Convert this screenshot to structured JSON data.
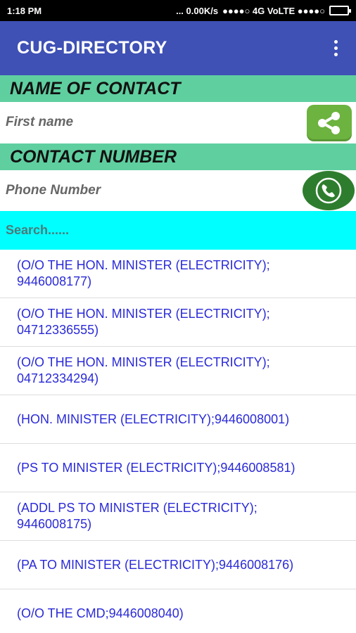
{
  "status_bar": {
    "time": "1:18 PM",
    "network_speed": "... 0.00K/s",
    "network_info": "●●●●○ 4G VoLTE ●●●●○"
  },
  "app_bar": {
    "title": "CUG-DIRECTORY",
    "menu_icon": "overflow-menu-icon"
  },
  "form": {
    "name_header": "NAME OF CONTACT",
    "first_name_placeholder": "First name",
    "number_header": "CONTACT NUMBER",
    "phone_placeholder": "Phone Number",
    "share_icon": "share-icon",
    "call_icon": "phone-icon"
  },
  "search": {
    "placeholder": "Search......"
  },
  "contacts": [
    "(O/O THE HON. MINISTER (ELECTRICITY);\n9446008177)",
    "(O/O THE HON. MINISTER (ELECTRICITY);\n04712336555)",
    "(O/O THE HON. MINISTER (ELECTRICITY);\n04712334294)",
    "(HON. MINISTER (ELECTRICITY);9446008001)",
    "(PS TO MINISTER (ELECTRICITY);9446008581)",
    "(ADDL PS TO MINISTER (ELECTRICITY);\n9446008175)",
    "(PA TO MINISTER (ELECTRICITY);9446008176)",
    "(O/O THE CMD;9446008040)"
  ],
  "colors": {
    "app_bar": "#3f51b5",
    "section_header": "#5fcfa0",
    "search_bar": "#00ffff",
    "list_text": "#2a2ad8",
    "share_button": "#6cb33f",
    "call_button": "#2e7d2e"
  }
}
